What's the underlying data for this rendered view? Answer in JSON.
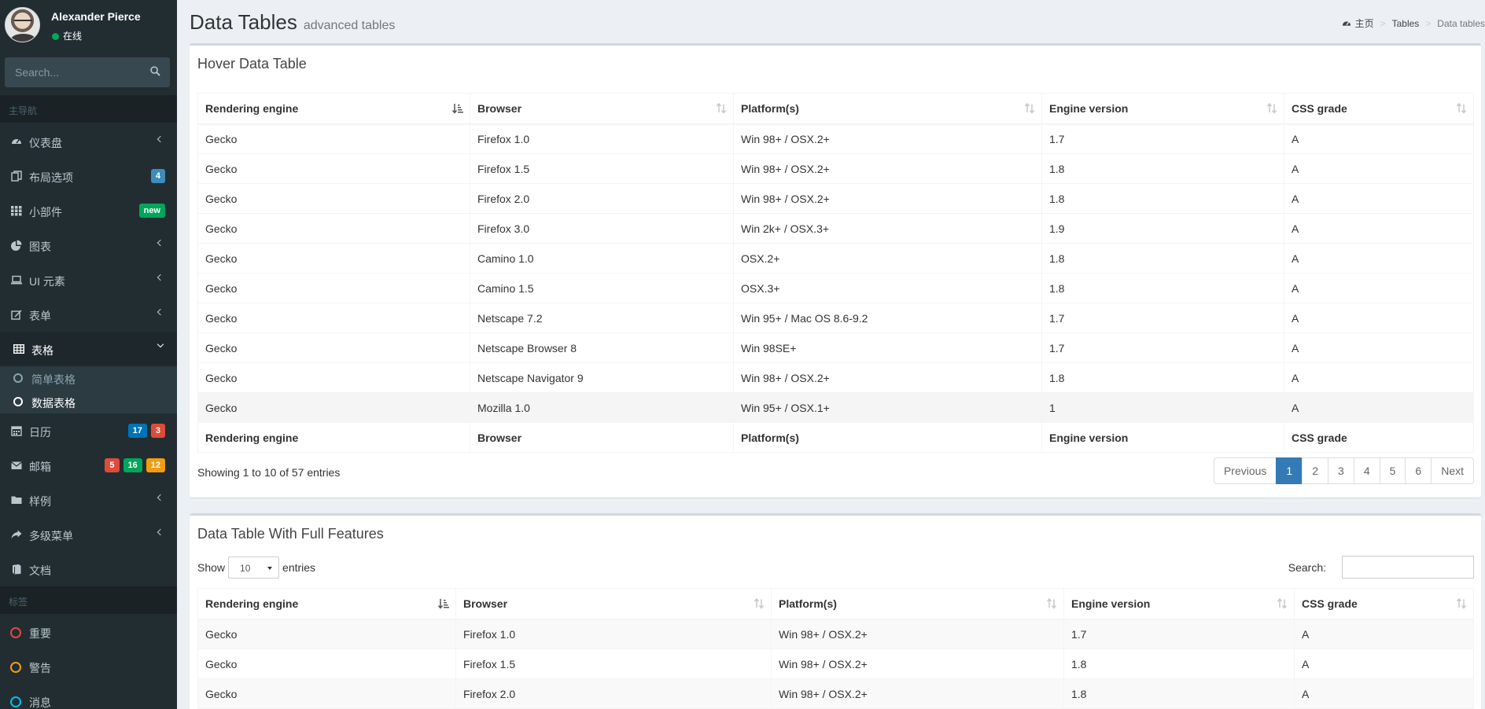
{
  "user": {
    "name": "Alexander Pierce",
    "status": "在线"
  },
  "sidebar_search": {
    "placeholder": "Search..."
  },
  "nav_header": "主导航",
  "menu": [
    {
      "label": "仪表盘",
      "icon": "dashboard-icon"
    },
    {
      "label": "布局选项",
      "icon": "files-icon",
      "badges": [
        "4"
      ]
    },
    {
      "label": "小部件",
      "icon": "grid-icon",
      "badges": [
        "new"
      ]
    },
    {
      "label": "图表",
      "icon": "pie-chart-icon"
    },
    {
      "label": "UI 元素",
      "icon": "laptop-icon"
    },
    {
      "label": "表单",
      "icon": "edit-icon"
    },
    {
      "label": "表格",
      "icon": "table-icon"
    },
    {
      "label": "日历",
      "icon": "calendar-icon",
      "badges": [
        "17",
        "3"
      ]
    },
    {
      "label": "邮箱",
      "icon": "envelope-icon",
      "badges": [
        "5",
        "16",
        "12"
      ]
    },
    {
      "label": "样例",
      "icon": "folder-icon"
    },
    {
      "label": "多级菜单",
      "icon": "share-icon"
    },
    {
      "label": "文档",
      "icon": "book-icon"
    }
  ],
  "submenu": [
    {
      "label": "简单表格"
    },
    {
      "label": "数据表格"
    }
  ],
  "labels_header": "标签",
  "labels": [
    {
      "label": "重要",
      "color": "#dd4b39"
    },
    {
      "label": "警告",
      "color": "#f39c12"
    },
    {
      "label": "消息",
      "color": "#00c0ef"
    }
  ],
  "page": {
    "title": "Data Tables",
    "subtitle": "advanced tables"
  },
  "breadcrumb": {
    "home": "主页",
    "section": "Tables",
    "current": "Data tables"
  },
  "table1": {
    "title": "Hover Data Table",
    "columns": [
      "Rendering engine",
      "Browser",
      "Platform(s)",
      "Engine version",
      "CSS grade"
    ],
    "rows": [
      [
        "Gecko",
        "Firefox 1.0",
        "Win 98+ / OSX.2+",
        "1.7",
        "A"
      ],
      [
        "Gecko",
        "Firefox 1.5",
        "Win 98+ / OSX.2+",
        "1.8",
        "A"
      ],
      [
        "Gecko",
        "Firefox 2.0",
        "Win 98+ / OSX.2+",
        "1.8",
        "A"
      ],
      [
        "Gecko",
        "Firefox 3.0",
        "Win 2k+ / OSX.3+",
        "1.9",
        "A"
      ],
      [
        "Gecko",
        "Camino 1.0",
        "OSX.2+",
        "1.8",
        "A"
      ],
      [
        "Gecko",
        "Camino 1.5",
        "OSX.3+",
        "1.8",
        "A"
      ],
      [
        "Gecko",
        "Netscape 7.2",
        "Win 95+ / Mac OS 8.6-9.2",
        "1.7",
        "A"
      ],
      [
        "Gecko",
        "Netscape Browser 8",
        "Win 98SE+",
        "1.7",
        "A"
      ],
      [
        "Gecko",
        "Netscape Navigator 9",
        "Win 98+ / OSX.2+",
        "1.8",
        "A"
      ],
      [
        "Gecko",
        "Mozilla 1.0",
        "Win 95+ / OSX.1+",
        "1",
        "A"
      ]
    ],
    "info": "Showing 1 to 10 of 57 entries",
    "pagination": [
      "Previous",
      "1",
      "2",
      "3",
      "4",
      "5",
      "6",
      "Next"
    ]
  },
  "table2": {
    "title": "Data Table With Full Features",
    "show_label": "Show",
    "entries_label": "entries",
    "page_size": "10",
    "search_label": "Search:",
    "columns": [
      "Rendering engine",
      "Browser",
      "Platform(s)",
      "Engine version",
      "CSS grade"
    ],
    "rows": [
      [
        "Gecko",
        "Firefox 1.0",
        "Win 98+ / OSX.2+",
        "1.7",
        "A"
      ],
      [
        "Gecko",
        "Firefox 1.5",
        "Win 98+ / OSX.2+",
        "1.8",
        "A"
      ],
      [
        "Gecko",
        "Firefox 2.0",
        "Win 98+ / OSX.2+",
        "1.8",
        "A"
      ]
    ]
  }
}
